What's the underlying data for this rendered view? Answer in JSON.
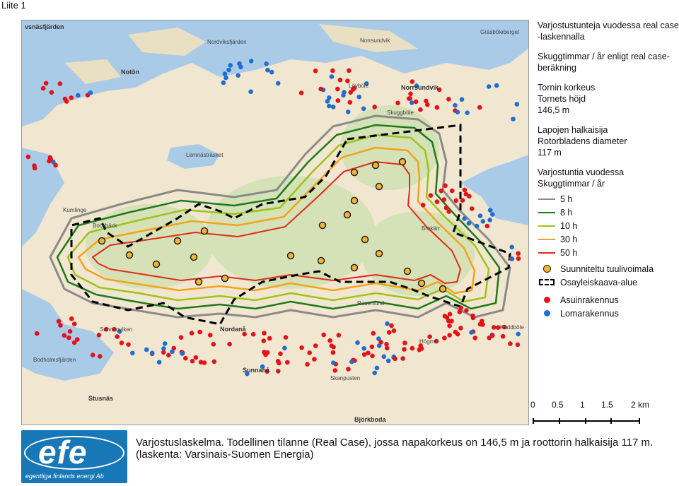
{
  "page_label": "Liite 1",
  "legend": {
    "title1": "Varjostustunteja vuodessa real case -laskennalla",
    "title2": "Skuggtimmar / år enligt real case-beräkning",
    "tower": [
      "Tornin korkeus",
      "Tornets höjd",
      "146,5 m"
    ],
    "rotor": [
      "Lapojen halkaisija",
      "Rotorbladens diameter",
      "117 m"
    ],
    "hours_title": [
      "Varjostuntia vuodessa",
      "Skuggtimmar / år"
    ],
    "contours": [
      {
        "label": "5 h",
        "color": "#8a8a8a"
      },
      {
        "label": "8 h",
        "color": "#1e7a1e"
      },
      {
        "label": "10 h",
        "color": "#9ec31a"
      },
      {
        "label": "30 h",
        "color": "#f2a31d"
      },
      {
        "label": "50 h",
        "color": "#e02b1c"
      }
    ],
    "turbine_label": "Suunniteltu tuulivoimala",
    "area_label": "Osayleiskaava-alue",
    "residence_label": "Asuinrakennus",
    "residence_color": "#e0141a",
    "holiday_label": "Lomarakennus",
    "holiday_color": "#1e6fd0"
  },
  "scale_bar": {
    "ticks": [
      "0",
      "0.5",
      "1",
      "1.5",
      "2 km"
    ]
  },
  "caption": [
    "Varjostuslaskelma. Todellinen tilanne (Real Case), jossa napakorkeus on 146,5 m ja roottorin halkaisija 117 m.",
    "(laskenta: Varsinais-Suomen Energia)"
  ],
  "logo": {
    "word": "efe",
    "subtitle": "egentliga finlands energi Ab"
  },
  "place_names": [
    "vsnäsfjärden",
    "Nordviksfjärden",
    "Norrsundvik",
    "Notön",
    "Lövböle",
    "Norrsundvik",
    "Skuggböle",
    "Lemnästräsket",
    "Kumlinge",
    "Bockbäck",
    "Brokärr",
    "Nordanå",
    "Sunnanå",
    "Sunnanviken",
    "Bodholmsfjärden",
    "Stusnäs",
    "Skanpusten",
    "Högmo",
    "Kaddböle",
    "Rosenlund",
    "Björkboda",
    "Gräsböleberget"
  ]
}
